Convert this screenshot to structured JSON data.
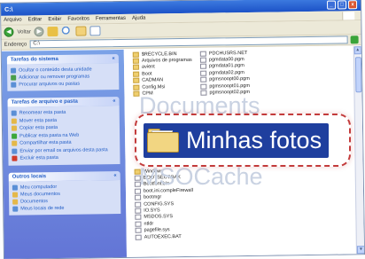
{
  "window": {
    "title": "C:\\",
    "controls": [
      "_",
      "□",
      "x"
    ]
  },
  "menu": [
    "Arquivo",
    "Editar",
    "Exibir",
    "Favoritos",
    "Ferramentas",
    "Ajuda"
  ],
  "toolbar": {
    "back_label": "Voltar"
  },
  "address": {
    "label": "Endereço",
    "value": "C:\\"
  },
  "panels": [
    {
      "title": "Tarefas do sistema",
      "items": [
        {
          "label": "Ocultar o conteúdo desta unidade",
          "icon": "hide-icon",
          "color": "#5a8fd6"
        },
        {
          "label": "Adicionar ou remover programas",
          "icon": "programs-icon",
          "color": "#4a9f4a"
        },
        {
          "label": "Procurar arquivos ou pastas",
          "icon": "search-icon",
          "color": "#5a8fd6"
        }
      ]
    },
    {
      "title": "Tarefas de arquivo e pasta",
      "items": [
        {
          "label": "Renomear esta pasta",
          "icon": "rename-icon",
          "color": "#5a8fd6"
        },
        {
          "label": "Mover esta pasta",
          "icon": "move-icon",
          "color": "#e4b84a"
        },
        {
          "label": "Copiar esta pasta",
          "icon": "copy-icon",
          "color": "#e4b84a"
        },
        {
          "label": "Publicar esta pasta na Web",
          "icon": "web-icon",
          "color": "#3da73a"
        },
        {
          "label": "Compartilhar esta pasta",
          "icon": "share-icon",
          "color": "#e4b84a"
        },
        {
          "label": "Enviar por email os arquivos desta pasta",
          "icon": "mail-icon",
          "color": "#5a8fd6"
        },
        {
          "label": "Excluir esta pasta",
          "icon": "delete-icon",
          "color": "#d03a2a"
        }
      ]
    },
    {
      "title": "Outros locais",
      "items": [
        {
          "label": "Meu computador",
          "icon": "computer-icon",
          "color": "#5a8fd6"
        },
        {
          "label": "Meus documentos",
          "icon": "documents-icon",
          "color": "#e4b84a"
        },
        {
          "label": "Documentos",
          "icon": "folder-icon",
          "color": "#e4b84a"
        },
        {
          "label": "Meus locais de rede",
          "icon": "network-icon",
          "color": "#5a8fd6"
        }
      ]
    }
  ],
  "files_col1_top": [
    {
      "name": "$RECYCLE.BIN",
      "type": "folder"
    },
    {
      "name": "Arquivos de programas",
      "type": "folder"
    },
    {
      "name": "avient",
      "type": "folder"
    },
    {
      "name": "Boot",
      "type": "folder"
    },
    {
      "name": "CADMAN",
      "type": "folder"
    },
    {
      "name": "Config.Msi",
      "type": "folder"
    },
    {
      "name": "CPM",
      "type": "folder"
    }
  ],
  "files_col1_bottom": [
    {
      "name": "Windows",
      "type": "folder"
    },
    {
      "name": "BOOTSECT.BAK",
      "type": "file"
    },
    {
      "name": "Bootfont.bin",
      "type": "file"
    },
    {
      "name": "boot.ini.compleFirewall",
      "type": "file"
    },
    {
      "name": "bootmgr",
      "type": "file"
    },
    {
      "name": "CONFIG.SYS",
      "type": "file"
    },
    {
      "name": "IO.SYS",
      "type": "file"
    },
    {
      "name": "MSDOS.SYS",
      "type": "file"
    },
    {
      "name": "ntldr",
      "type": "file"
    },
    {
      "name": "pagefile.sys",
      "type": "file"
    },
    {
      "name": "AUTOEXEC.BAT",
      "type": "file"
    }
  ],
  "files_col2": [
    {
      "name": "PDCHUSRS.NET",
      "type": "file"
    },
    {
      "name": "pgmdata00.pgm",
      "type": "file"
    },
    {
      "name": "pgmdata01.pgm",
      "type": "file"
    },
    {
      "name": "pgmdata02.pgm",
      "type": "file"
    },
    {
      "name": "pgmsnoopt00.pgm",
      "type": "file"
    },
    {
      "name": "pgmsnoopt01.pgm",
      "type": "file"
    },
    {
      "name": "pgmsnoopt02.pgm",
      "type": "file"
    }
  ],
  "background_labels": {
    "above": "Documents",
    "below": "MSOCache"
  },
  "zoom": {
    "label": "Minhas fotos"
  },
  "colors": {
    "taskpane": "#6375d6",
    "selection": "#1f3f9e",
    "highlight": "#c33b3b"
  }
}
